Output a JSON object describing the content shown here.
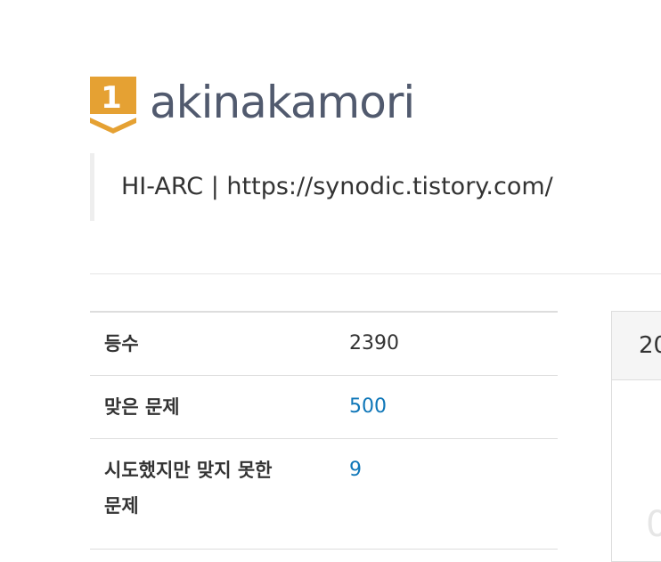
{
  "profile": {
    "tier_number": "1",
    "tier_color": "#e5a133",
    "username": "akinakamori",
    "bio": "HI-ARC | https://synodic.tistory.com/"
  },
  "stats": [
    {
      "label": "등수",
      "value": "2390",
      "link": false
    },
    {
      "label": "맞은 문제",
      "value": "500",
      "link": true
    },
    {
      "label_line1": "시도했지만 맞지 못한",
      "label_line2": "문제",
      "value": "9",
      "link": true
    }
  ],
  "right_panel": {
    "header_text": "20",
    "faint_glyph": "0"
  },
  "colors": {
    "link": "#0e76b8",
    "username": "#515a6e",
    "border": "#dddddd"
  }
}
